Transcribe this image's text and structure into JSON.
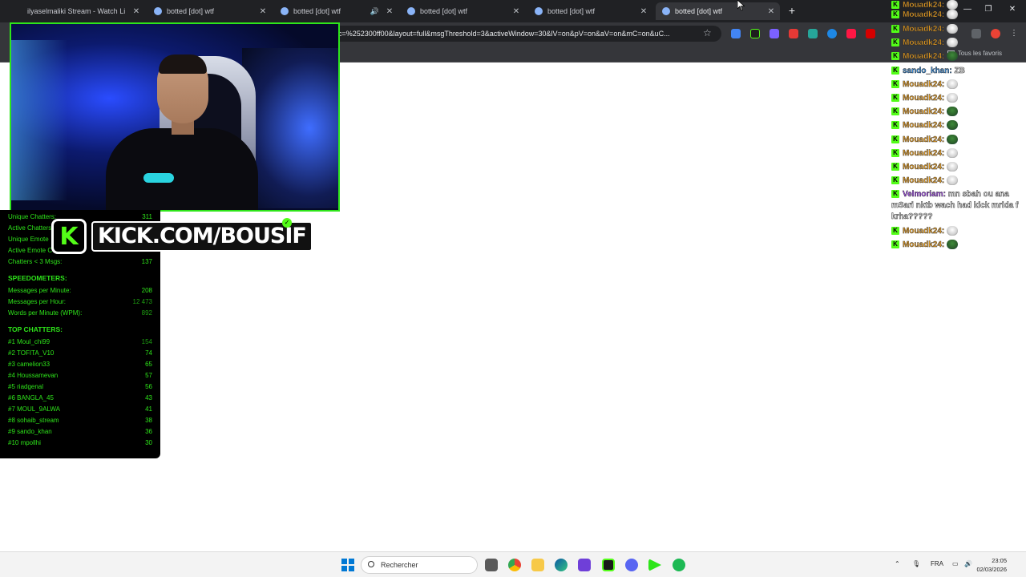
{
  "browser": {
    "tabs": [
      {
        "title": "ilyaselmaliki Stream - Watch Li",
        "icon": "kick-icon",
        "active": false
      },
      {
        "title": "botted [dot] wtf",
        "icon": "bot-icon",
        "active": false
      },
      {
        "title": "botted [dot] wtf",
        "icon": "bot-icon",
        "active": false,
        "audio": true
      },
      {
        "title": "botted [dot] wtf",
        "icon": "bot-icon",
        "active": false
      },
      {
        "title": "botted [dot] wtf",
        "icon": "bot-icon",
        "active": false
      },
      {
        "title": "botted [dot] wtf",
        "icon": "bot-icon",
        "active": true
      }
    ],
    "close_glyph": "✕",
    "new_tab_glyph": "+",
    "url": "c=%252300ff00&layout=full&msgThreshold=3&activeWindow=30&lV=on&pV=on&aV=on&mC=on&uC...",
    "bookmarks_label": "Tous les favoris"
  },
  "overlay": {
    "kick_banner": "KICK.COM/BOUSIF",
    "kick_logo": "K"
  },
  "stats": {
    "rows_top": [
      {
        "label": "Unique Chatters:",
        "value": "311"
      },
      {
        "label": "Active Chatters",
        "value": ""
      },
      {
        "label": "Unique Emote",
        "value": ""
      },
      {
        "label": "Active Emote C",
        "value": ""
      },
      {
        "label": "Chatters < 3 Msgs:",
        "value": "137"
      }
    ],
    "speed_title": "SPEEDOMETERS:",
    "speed_rows": [
      {
        "label": "Messages per Minute:",
        "value": "208"
      },
      {
        "label": "Messages per Hour:",
        "value": "12 473"
      },
      {
        "label": "Words per Minute (WPM):",
        "value": "892"
      }
    ],
    "top_title": "TOP CHATTERS:",
    "top_rows": [
      {
        "label": "#1 Moul_chi99",
        "value": "154"
      },
      {
        "label": "#2 TOFITA_V10",
        "value": "74"
      },
      {
        "label": "#3 camelion33",
        "value": "65"
      },
      {
        "label": "#4 Houssamevan",
        "value": "57"
      },
      {
        "label": "#5 riadgenal",
        "value": "56"
      },
      {
        "label": "#6 BANGLA_45",
        "value": "43"
      },
      {
        "label": "#7 MOUL_9ALWA",
        "value": "41"
      },
      {
        "label": "#8 sohaib_stream",
        "value": "38"
      },
      {
        "label": "#9 sando_khan",
        "value": "36"
      },
      {
        "label": "#10 mpollhi",
        "value": "30"
      }
    ]
  },
  "chat": {
    "messages": [
      {
        "user": "Mouadk24:",
        "color": "orange",
        "text": "",
        "emote": "white"
      },
      {
        "user": "Mouadk24:",
        "color": "orange",
        "text": "",
        "emote": "white"
      },
      {
        "user": "Mouadk24:",
        "color": "orange",
        "text": "",
        "emote": "white"
      },
      {
        "user": "Mouadk24:",
        "color": "orange",
        "text": "",
        "emote": "white"
      },
      {
        "user": "Mouadk24:",
        "color": "orange",
        "text": "",
        "emote": "green"
      },
      {
        "user": "sando_khan:",
        "color": "blue",
        "text": "ZB",
        "emote": ""
      },
      {
        "user": "Mouadk24:",
        "color": "orange",
        "text": "",
        "emote": "white"
      },
      {
        "user": "Mouadk24:",
        "color": "orange",
        "text": "",
        "emote": "white"
      },
      {
        "user": "Mouadk24:",
        "color": "orange",
        "text": "",
        "emote": "green"
      },
      {
        "user": "Mouadk24:",
        "color": "orange",
        "text": "",
        "emote": "green"
      },
      {
        "user": "Mouadk24:",
        "color": "orange",
        "text": "",
        "emote": "green"
      },
      {
        "user": "Mouadk24:",
        "color": "orange",
        "text": "",
        "emote": "white"
      },
      {
        "user": "Mouadk24:",
        "color": "orange",
        "text": "",
        "emote": "white"
      },
      {
        "user": "Mouadk24:",
        "color": "orange",
        "text": "",
        "emote": "white"
      },
      {
        "user": "Velmoriam:",
        "color": "purple",
        "text": "mn sbah ou ana mSari nktb wach had kick mrida f krha?????",
        "emote": ""
      },
      {
        "user": "Mouadk24:",
        "color": "orange",
        "text": "",
        "emote": "white"
      },
      {
        "user": "Mouadk24:",
        "color": "orange",
        "text": "",
        "emote": "green"
      }
    ]
  },
  "taskbar": {
    "search_placeholder": "Rechercher",
    "lang": "FRA",
    "time": "23:05",
    "date": "02/03/2026"
  }
}
